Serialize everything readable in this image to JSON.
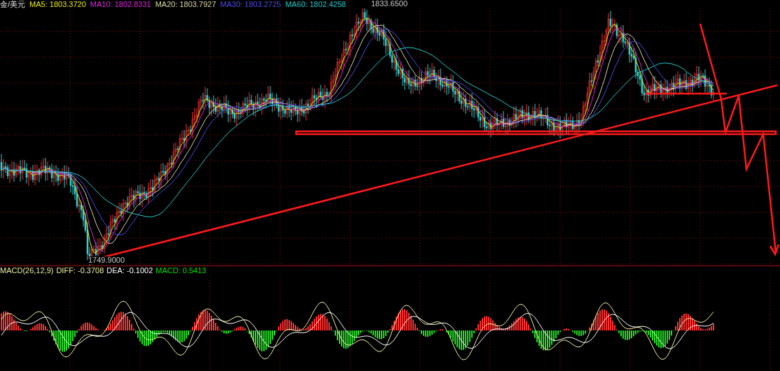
{
  "title": "金/美元",
  "ma_legend": [
    {
      "label": "MA5: 1803.3720",
      "color": "#e8e800"
    },
    {
      "label": "MA10: 1802.8331",
      "color": "#e020e0"
    },
    {
      "label": "MA20: 1803.7927",
      "color": "#d8d8a8"
    },
    {
      "label": "MA30: 1803.2725",
      "color": "#4a4ae8"
    },
    {
      "label": "MA60: 1802.4258",
      "color": "#20c8c8"
    }
  ],
  "price_labels": [
    {
      "text": "1833.6500",
      "kind": "high"
    },
    {
      "text": "1749.9000",
      "kind": "low"
    }
  ],
  "macd_legend": [
    {
      "label": "MACD(26,12,9)",
      "color": "#e8e8a0"
    },
    {
      "label": "DIFF: -0.3708",
      "color": "#f0f0a0"
    },
    {
      "label": "DEA: -0.1002",
      "color": "#ffffff"
    },
    {
      "label": "MACD: 0.5413",
      "color": "#00e000"
    }
  ]
}
